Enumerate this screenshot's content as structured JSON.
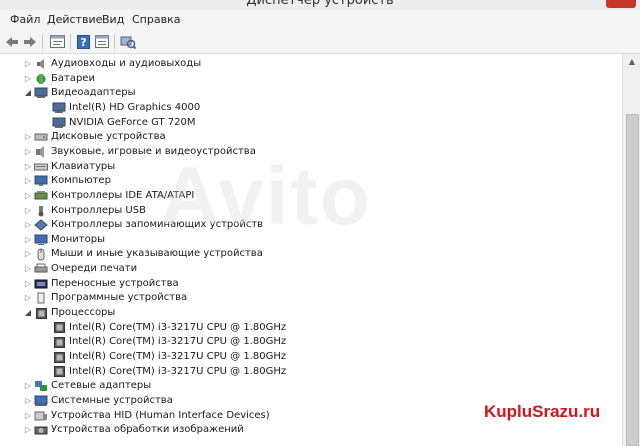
{
  "window": {
    "title": "Диспетчер устройств"
  },
  "menu": [
    "Файл",
    "Действие",
    "Вид",
    "Справка"
  ],
  "toolbar_icons": [
    "back-arrow-icon",
    "forward-arrow-icon",
    "properties-icon",
    "help-icon",
    "details-icon",
    "scan-hardware-icon"
  ],
  "tree": [
    {
      "label": "Аудиовходы и аудиовыходы",
      "icon": "speaker-icon",
      "level": 0,
      "expander": "collapsed"
    },
    {
      "label": "Батареи",
      "icon": "battery-icon",
      "level": 0,
      "expander": "collapsed"
    },
    {
      "label": "Видеоадаптеры",
      "icon": "display-adapter-icon",
      "level": 0,
      "expander": "expanded"
    },
    {
      "label": "Intel(R) HD Graphics 4000",
      "icon": "display-adapter-icon",
      "level": 1,
      "expander": "none"
    },
    {
      "label": "NVIDIA GeForce GT 720M",
      "icon": "display-adapter-icon",
      "level": 1,
      "expander": "none"
    },
    {
      "label": "Дисковые устройства",
      "icon": "disk-drive-icon",
      "level": 0,
      "expander": "collapsed"
    },
    {
      "label": "Звуковые, игровые и видеоустройства",
      "icon": "sound-device-icon",
      "level": 0,
      "expander": "collapsed"
    },
    {
      "label": "Клавиатуры",
      "icon": "keyboard-icon",
      "level": 0,
      "expander": "collapsed"
    },
    {
      "label": "Компьютер",
      "icon": "computer-icon",
      "level": 0,
      "expander": "collapsed"
    },
    {
      "label": "Контроллеры IDE ATA/ATAPI",
      "icon": "ide-controller-icon",
      "level": 0,
      "expander": "collapsed"
    },
    {
      "label": "Контроллеры USB",
      "icon": "usb-icon",
      "level": 0,
      "expander": "collapsed"
    },
    {
      "label": "Контроллеры запоминающих устройств",
      "icon": "storage-controller-icon",
      "level": 0,
      "expander": "collapsed"
    },
    {
      "label": "Мониторы",
      "icon": "monitor-icon",
      "level": 0,
      "expander": "collapsed"
    },
    {
      "label": "Мыши и иные указывающие устройства",
      "icon": "mouse-icon",
      "level": 0,
      "expander": "collapsed"
    },
    {
      "label": "Очереди печати",
      "icon": "printer-icon",
      "level": 0,
      "expander": "collapsed"
    },
    {
      "label": "Переносные устройства",
      "icon": "portable-device-icon",
      "level": 0,
      "expander": "collapsed"
    },
    {
      "label": "Программные устройства",
      "icon": "software-device-icon",
      "level": 0,
      "expander": "collapsed"
    },
    {
      "label": "Процессоры",
      "icon": "processor-icon",
      "level": 0,
      "expander": "expanded"
    },
    {
      "label": "Intel(R) Core(TM) i3-3217U CPU @ 1.80GHz",
      "icon": "processor-icon",
      "level": 1,
      "expander": "none"
    },
    {
      "label": "Intel(R) Core(TM) i3-3217U CPU @ 1.80GHz",
      "icon": "processor-icon",
      "level": 1,
      "expander": "none"
    },
    {
      "label": "Intel(R) Core(TM) i3-3217U CPU @ 1.80GHz",
      "icon": "processor-icon",
      "level": 1,
      "expander": "none"
    },
    {
      "label": "Intel(R) Core(TM) i3-3217U CPU @ 1.80GHz",
      "icon": "processor-icon",
      "level": 1,
      "expander": "none"
    },
    {
      "label": "Сетевые адаптеры",
      "icon": "network-adapter-icon",
      "level": 0,
      "expander": "collapsed"
    },
    {
      "label": "Системные устройства",
      "icon": "system-device-icon",
      "level": 0,
      "expander": "collapsed"
    },
    {
      "label": "Устройства HID (Human Interface Devices)",
      "icon": "hid-icon",
      "level": 0,
      "expander": "collapsed"
    },
    {
      "label": "Устройства обработки изображений",
      "icon": "camera-icon",
      "level": 0,
      "expander": "collapsed"
    }
  ],
  "watermark": {
    "text": "Avito",
    "logo_text": "KupluSrazu.ru"
  }
}
